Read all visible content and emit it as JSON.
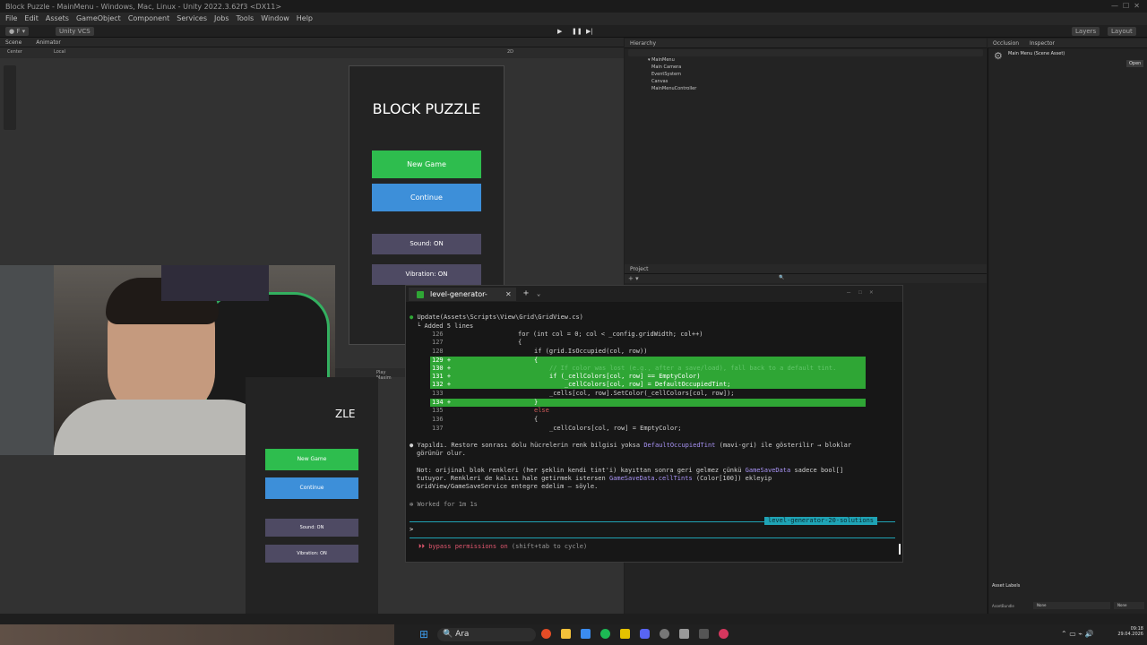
{
  "window": {
    "title": "Block Puzzle - MainMenu - Windows, Mac, Linux - Unity 2022.3.62f3 <DX11>"
  },
  "menu": [
    "File",
    "Edit",
    "Assets",
    "GameObject",
    "Component",
    "Services",
    "Jobs",
    "Tools",
    "Window",
    "Help"
  ],
  "toolbar": {
    "vcs": "Unity VCS",
    "layers": "Layers",
    "layout": "Layout",
    "center": "Center",
    "local": "Local",
    "mode_2d": "2D"
  },
  "scene_tabs": [
    "Scene",
    "Animator"
  ],
  "game": {
    "title": "BLOCK PUZZLE",
    "new_game": "New Game",
    "continue": "Continue",
    "sound": "Sound: ON",
    "vibration": "Vibration: ON",
    "title_fragment": "ZLE",
    "play_label": "Play Maxim"
  },
  "hierarchy": {
    "tab": "Hierarchy",
    "scene": "MainMenu",
    "items": [
      "Main Camera",
      "EventSystem",
      "Canvas",
      "MainMenuController"
    ]
  },
  "project": {
    "tab": "Project"
  },
  "inspector": {
    "tabs": [
      "Occlusion",
      "Inspector"
    ],
    "scene_asset": "Main Menu (Scene Asset)",
    "open": "Open",
    "asset_labels": "Asset Labels",
    "asset_bundle": "AssetBundle",
    "none1": "None",
    "none2": "None"
  },
  "terminal": {
    "tab_title": "level-generator-",
    "update_line": "Update(Assets\\Scripts\\View\\Grid\\GridView.cs)",
    "added": "Added 5 lines",
    "code": [
      {
        "n": "126",
        "t": "for (int col = 0; col < _config.gridWidth; col++)"
      },
      {
        "n": "127",
        "t": "{"
      },
      {
        "n": "128",
        "t": "if (grid.IsOccupied(col, row))"
      },
      {
        "n": "129 +",
        "t": "{"
      },
      {
        "n": "130 +",
        "t": "// If color was lost (e.g., after a save/load), fall back to a default tint."
      },
      {
        "n": "131 +",
        "t": "if (_cellColors[col, row] == EmptyColor)"
      },
      {
        "n": "132 +",
        "t": "    _cellColors[col, row] = DefaultOccupiedTint;"
      },
      {
        "n": "133",
        "t": "_cells[col, row].SetColor(_cellColors[col, row]);"
      },
      {
        "n": "134 +",
        "t": "}"
      },
      {
        "n": "135",
        "t": "else"
      },
      {
        "n": "136",
        "t": "{"
      },
      {
        "n": "137",
        "t": "_cellColors[col, row] = EmptyColor;"
      }
    ],
    "summary_a": "Yapıldı. Restore sonrası dolu hücrelerin renk bilgisi yoksa ",
    "summary_b": "DefaultOccupiedTint",
    "summary_c": " (mavi-gri) ile gösterilir → bloklar",
    "summary_d": "görünür olur.",
    "note1a": "Not: orijinal blok renkleri (her şeklin kendi tint'i) kayıttan sonra geri gelmez çünkü ",
    "note1b": "GameSaveData",
    "note1c": " sadece bool[]",
    "note2a": "tutuyor. Renkleri de kalıcı hale getirmek istersen ",
    "note2b": "GameSaveData.cellTints",
    "note2c": " (Color[100]) ekleyip",
    "note3": "GridView/GameSaveService entegre edelim — söyle.",
    "worked": "Worked for 1m 1s",
    "branch": "level-generator-20-solutions",
    "prompt": ">",
    "bypass_a": "⏵⏵ bypass permissions on",
    "bypass_b": " (shift+tab to cycle)"
  },
  "taskbar": {
    "search": "Ara",
    "time": "09:18",
    "date": "29.04.2026"
  },
  "colors": {
    "green": "#2ebd4e",
    "blue": "#3d8fd9",
    "dark_button": "#4e4a63",
    "diff_green": "#2fa635",
    "branch": "#1fa3b5"
  }
}
